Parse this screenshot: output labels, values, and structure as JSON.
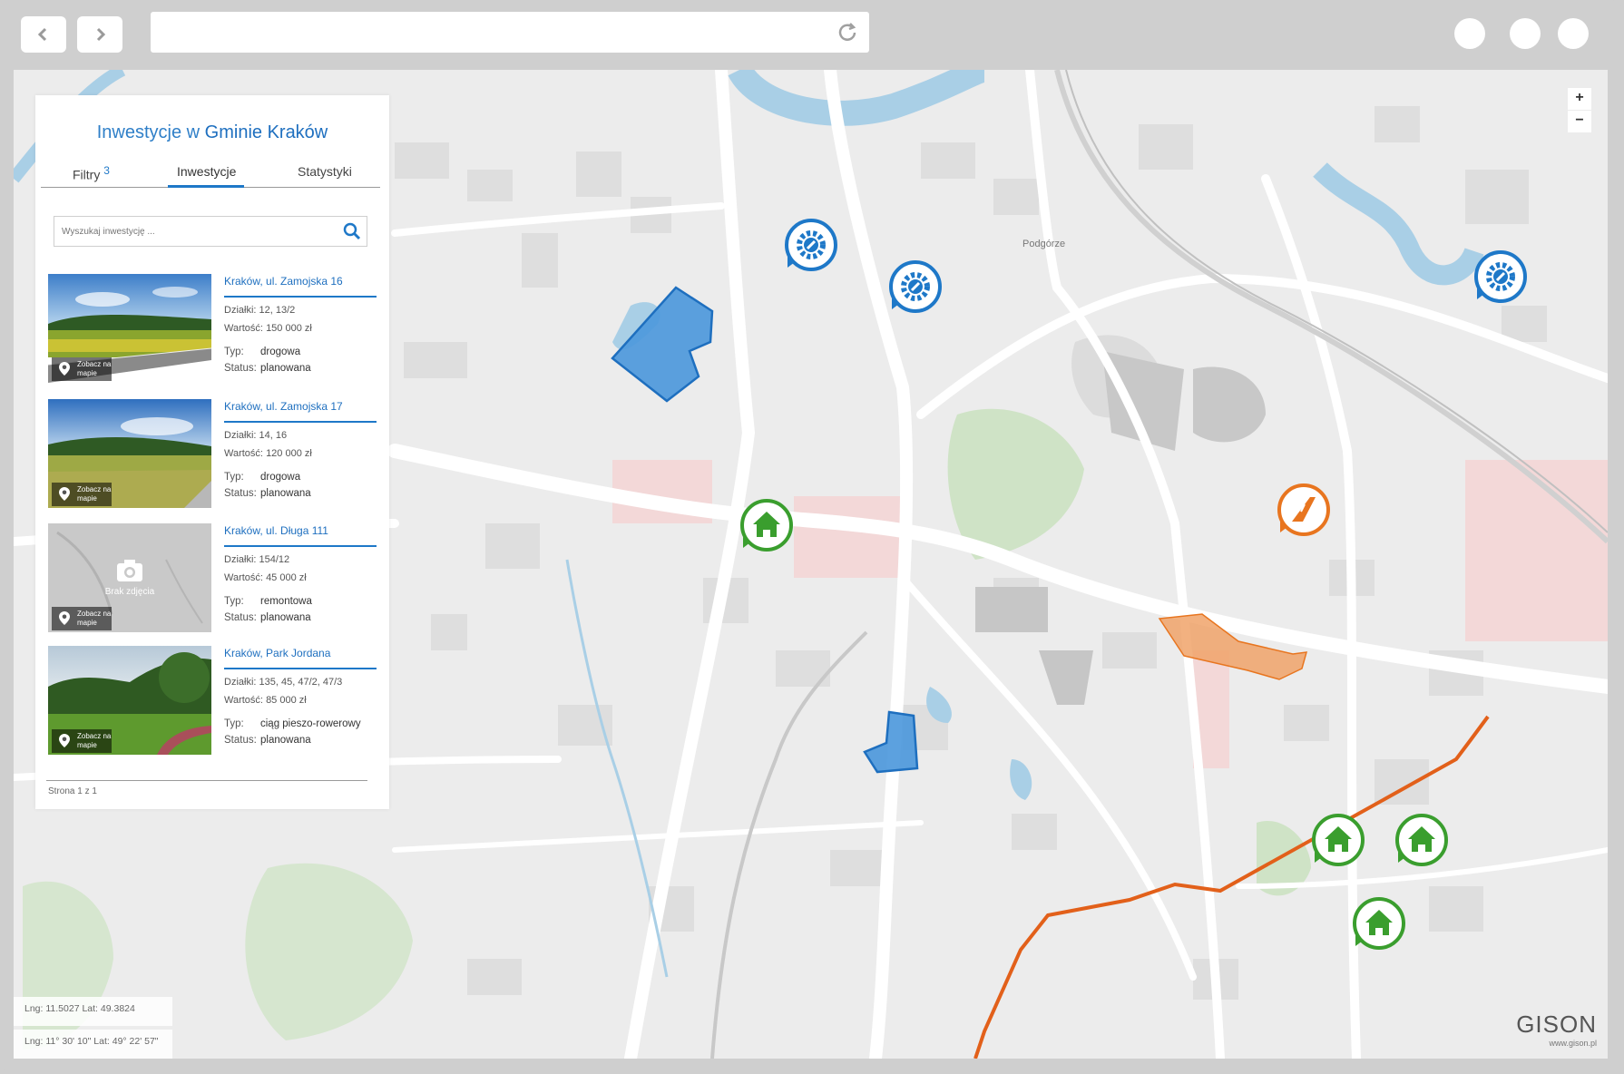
{
  "panel": {
    "title_prefix": "Inwestycje w",
    "title_strong": "Gminie Kraków",
    "tabs": [
      {
        "label": "Filtry",
        "badge": "3"
      },
      {
        "label": "Inwestycje"
      },
      {
        "label": "Statystyki"
      }
    ],
    "search_placeholder": "Wyszukaj inwestycję ...",
    "see_on_map": "Zobacz na mapie",
    "no_photo": "Brak zdjęcia",
    "pager": "Strona 1 z 1",
    "labels": {
      "dzialki": "Działki:",
      "wartosc": "Wartość:",
      "typ": "Typ:",
      "status": "Status:"
    },
    "items": [
      {
        "title": "Kraków, ul. Zamojska 16",
        "dzialki": "12, 13/2",
        "wartosc": "150 000 zł",
        "typ": "drogowa",
        "status": "planowana"
      },
      {
        "title": "Kraków, ul. Zamojska 17",
        "dzialki": "14, 16",
        "wartosc": "120 000 zł",
        "typ": "drogowa",
        "status": "planowana"
      },
      {
        "title": "Kraków, ul. Długa 111",
        "dzialki": "154/12",
        "wartosc": "45 000 zł",
        "typ": "remontowa",
        "status": "planowana"
      },
      {
        "title": "Kraków, Park Jordana",
        "dzialki": "135, 45, 47/2, 47/3",
        "wartosc": "85 000 zł",
        "typ": "ciąg pieszo-rowerowy",
        "status": "planowana"
      }
    ]
  },
  "map": {
    "place_label": "Podgórze",
    "zoom_in": "+",
    "zoom_out": "−",
    "coords_decimal": "Lng: 11.5027 Lat: 49.3824",
    "coords_dms": "Lng: 11° 30' 10\" Lat: 49° 22' 57\"",
    "brand": "GISON",
    "brand_url": "www.gison.pl",
    "colors": {
      "blue": "#1e78c8",
      "green": "#3a9e2e",
      "orange": "#e8751f",
      "route": "#e2601a"
    }
  }
}
